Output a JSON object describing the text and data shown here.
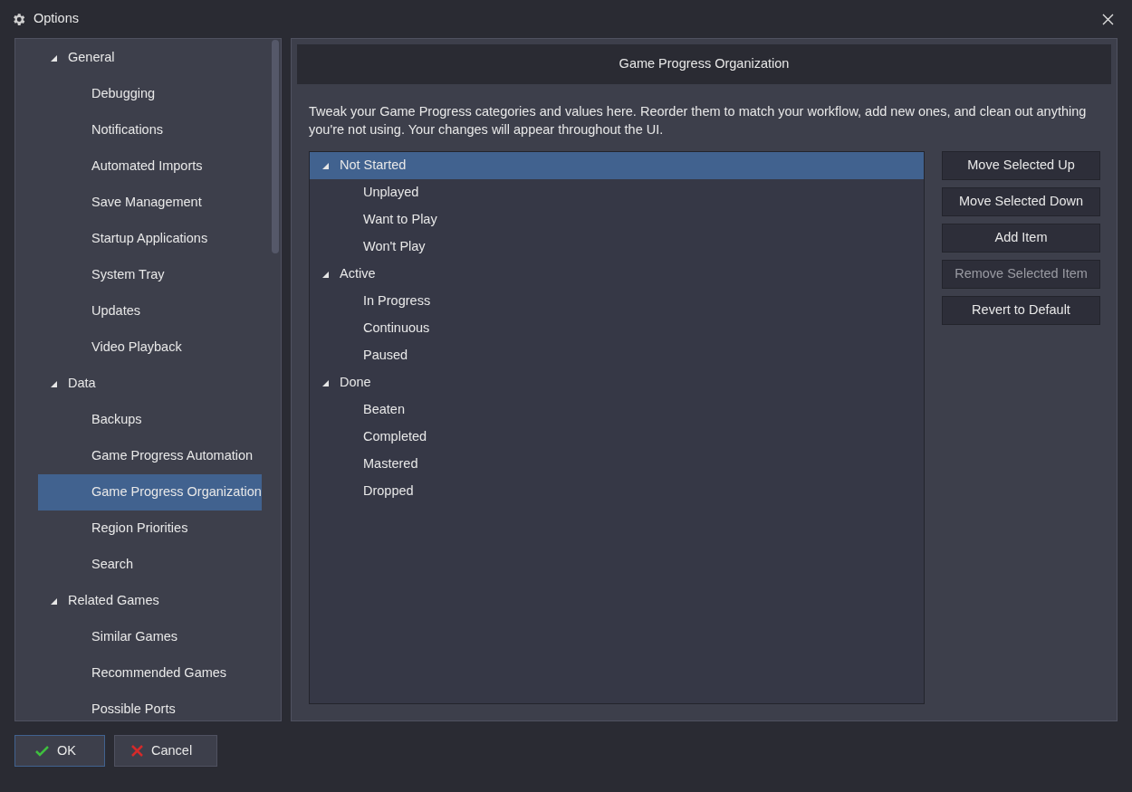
{
  "window": {
    "title": "Options"
  },
  "sidebar": {
    "items": [
      {
        "label": "General",
        "expanded": true,
        "selected": false,
        "children": [
          {
            "label": "Debugging",
            "selected": false
          },
          {
            "label": "Notifications",
            "selected": false
          },
          {
            "label": "Automated Imports",
            "selected": false
          },
          {
            "label": "Save Management",
            "selected": false
          },
          {
            "label": "Startup Applications",
            "selected": false
          },
          {
            "label": "System Tray",
            "selected": false
          },
          {
            "label": "Updates",
            "selected": false
          },
          {
            "label": "Video Playback",
            "selected": false
          }
        ]
      },
      {
        "label": "Data",
        "expanded": true,
        "selected": false,
        "children": [
          {
            "label": "Backups",
            "selected": false
          },
          {
            "label": "Game Progress Automation",
            "selected": false
          },
          {
            "label": "Game Progress Organization",
            "selected": true
          },
          {
            "label": "Region Priorities",
            "selected": false
          },
          {
            "label": "Search",
            "selected": false
          }
        ]
      },
      {
        "label": "Related Games",
        "expanded": true,
        "selected": false,
        "children": [
          {
            "label": "Similar Games",
            "selected": false
          },
          {
            "label": "Recommended Games",
            "selected": false
          },
          {
            "label": "Possible Ports",
            "selected": false
          }
        ]
      }
    ]
  },
  "content": {
    "title": "Game Progress Organization",
    "description": "Tweak your Game Progress categories and values here. Reorder them to match your workflow, add new ones, and clean out anything you're not using. Your changes will appear throughout the UI.",
    "tree": [
      {
        "label": "Not Started",
        "expanded": true,
        "selected": true,
        "children": [
          {
            "label": "Unplayed",
            "selected": false
          },
          {
            "label": "Want to Play",
            "selected": false
          },
          {
            "label": "Won't Play",
            "selected": false
          }
        ]
      },
      {
        "label": "Active",
        "expanded": true,
        "selected": false,
        "children": [
          {
            "label": "In Progress",
            "selected": false
          },
          {
            "label": "Continuous",
            "selected": false
          },
          {
            "label": "Paused",
            "selected": false
          }
        ]
      },
      {
        "label": "Done",
        "expanded": true,
        "selected": false,
        "children": [
          {
            "label": "Beaten",
            "selected": false
          },
          {
            "label": "Completed",
            "selected": false
          },
          {
            "label": "Mastered",
            "selected": false
          },
          {
            "label": "Dropped",
            "selected": false
          }
        ]
      }
    ],
    "buttons": [
      {
        "label": "Move Selected Up",
        "disabled": false
      },
      {
        "label": "Move Selected Down",
        "disabled": false
      },
      {
        "label": "Add Item",
        "disabled": false
      },
      {
        "label": "Remove Selected Item",
        "disabled": true
      },
      {
        "label": "Revert to Default",
        "disabled": false
      }
    ]
  },
  "footer": {
    "buttons": [
      {
        "label": "OK",
        "kind": "ok",
        "focused": true
      },
      {
        "label": "Cancel",
        "kind": "cancel",
        "focused": false
      }
    ]
  }
}
